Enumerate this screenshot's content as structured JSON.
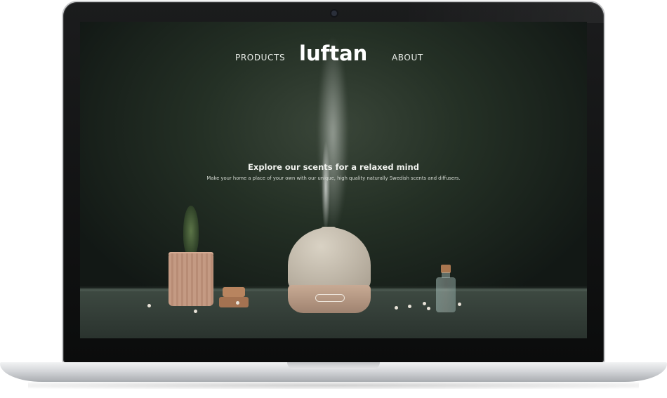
{
  "nav": {
    "products_label": "PRODUCTS",
    "about_label": "ABOUT",
    "logo_text": "luftan"
  },
  "hero": {
    "title": "Explore our scents for a relaxed mind",
    "subtitle": "Make your home a place of your own with our unique, high quality naturally Swedish scents and diffusers."
  },
  "colors": {
    "background_dark": "#1c241e",
    "text_light": "#f1f3ef"
  }
}
